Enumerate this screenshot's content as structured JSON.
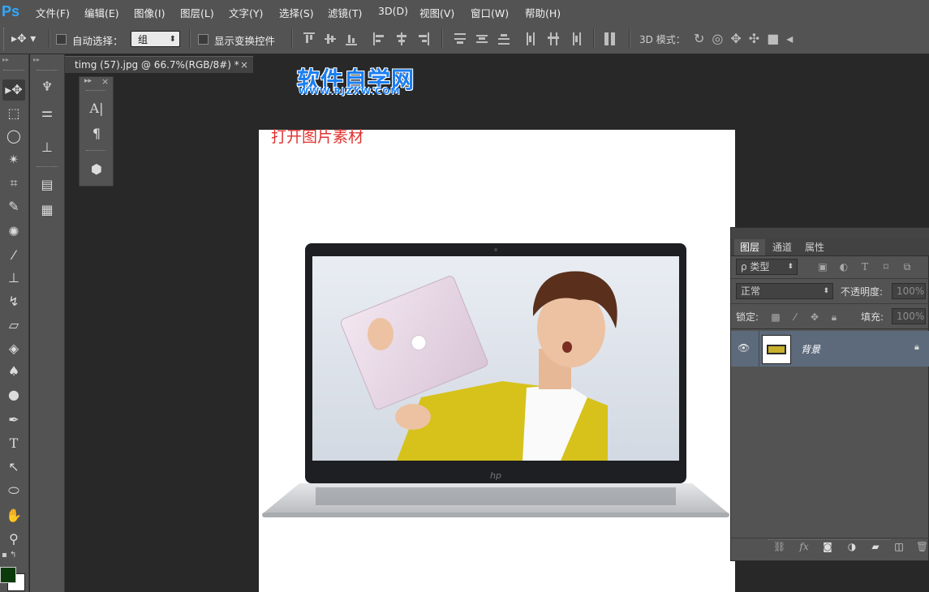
{
  "app": {
    "logo": "Ps"
  },
  "menu": [
    {
      "label": "文件(F)"
    },
    {
      "label": "编辑(E)"
    },
    {
      "label": "图像(I)"
    },
    {
      "label": "图层(L)"
    },
    {
      "label": "文字(Y)"
    },
    {
      "label": "选择(S)"
    },
    {
      "label": "滤镜(T)"
    },
    {
      "label": "3D(D)"
    },
    {
      "label": "视图(V)"
    },
    {
      "label": "窗口(W)"
    },
    {
      "label": "帮助(H)"
    }
  ],
  "options": {
    "auto_select_label": "自动选择：",
    "auto_select_value": "组",
    "show_transform_label": "显示变换控件",
    "mode_3d_label": "3D 模式："
  },
  "document": {
    "tab_title": "timg (57).jpg @ 66.7%(RGB/8#) *",
    "close_glyph": "×",
    "caption": "打开图片素材"
  },
  "watermark": {
    "text": "软件自学网",
    "url": "WWW.RJZXW.COM"
  },
  "colors": {
    "foreground": "#0b3b0b",
    "background": "#ffffff",
    "accent": "#31a8ff",
    "caption": "#e0322f"
  },
  "layers_panel": {
    "tabs": [
      {
        "label": "图层"
      },
      {
        "label": "通道"
      },
      {
        "label": "属性"
      }
    ],
    "filter_label": "ρ 类型",
    "blend_mode": "正常",
    "opacity_label": "不透明度:",
    "opacity_value": "100%",
    "lock_label": "锁定:",
    "fill_label": "填充:",
    "fill_value": "100%",
    "layers": [
      {
        "name": "背景",
        "locked": true,
        "visible": true
      }
    ]
  }
}
